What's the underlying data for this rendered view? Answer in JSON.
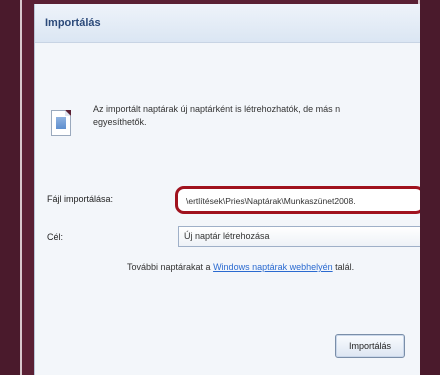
{
  "dialog": {
    "title": "Importálás",
    "info_icon": "calendar-info-icon",
    "info_line1": "Az importált naptárak új naptárként is létrehozhatók, de más n",
    "info_line2": "egyesíthetők."
  },
  "form": {
    "file_label": "Fájl importálása:",
    "file_value": "\\ertlítések\\Pries\\Naptárak\\Munkaszünet2008.",
    "target_label": "Cél:",
    "target_value": "Új naptár létrehozása",
    "more_prefix": "További naptárakat a ",
    "more_link": "Windows naptárak webhelyén",
    "more_suffix": " talál."
  },
  "buttons": {
    "import_label": "Importálás"
  },
  "colors": {
    "highlight": "#a0121e",
    "link": "#2a6ad0",
    "background": "#5a2034"
  }
}
